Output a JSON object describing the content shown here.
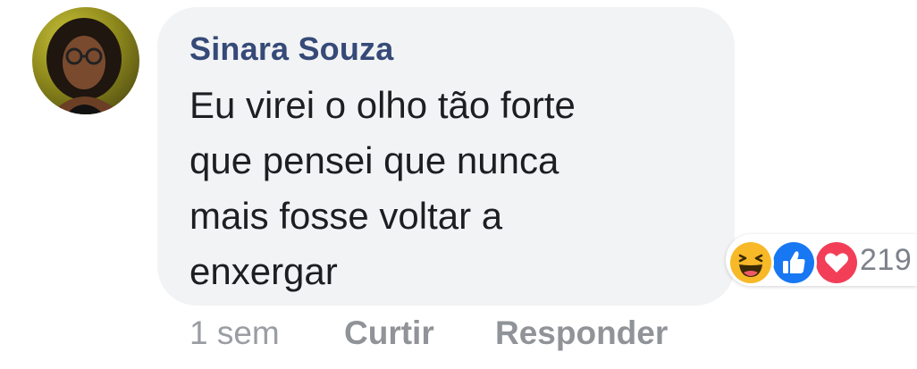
{
  "comment": {
    "author": "Sinara Souza",
    "text": "Eu virei o olho tão forte\nque pensei que nunca\nmais fosse voltar a\nenxergar",
    "timestamp": "1 sem",
    "like_label": "Curtir",
    "reply_label": "Responder"
  },
  "reactions": {
    "icons": [
      "haha-icon",
      "like-icon",
      "love-icon"
    ],
    "count": "219"
  },
  "colors": {
    "bubble": "#f2f3f5",
    "author": "#364a78",
    "haha": "#f7b928",
    "like": "#1877f2",
    "love": "#f33e58"
  }
}
